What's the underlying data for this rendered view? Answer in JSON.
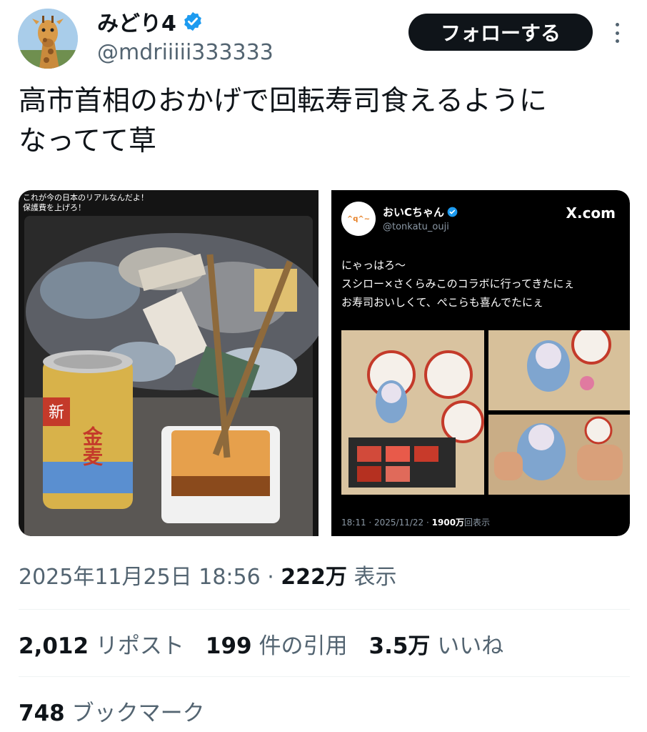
{
  "author": {
    "display_name": "みどり4",
    "handle": "@mdriiiii333333",
    "verified": true,
    "avatar_icon": "giraffe-avatar"
  },
  "actions": {
    "follow_label": "フォローする",
    "more_icon": "more-dots-icon"
  },
  "tweet": {
    "text": "高市首相のおかげで回転寿司食えるように\nなってて草"
  },
  "media": {
    "left_photo": {
      "overlay_line1": "これが今の日本のリアルなんだよ！",
      "overlay_line2": "保護費を上げろ！",
      "can_label": "金麦"
    },
    "right_embed": {
      "avatar_text": "^q^~",
      "name": "おいCちゃん",
      "handle": "@tonkatu_ouji",
      "brand": "X.com",
      "lines": [
        "にゃっはろ〜",
        "スシロー×さくらみこのコラボに行ってきたにぇ",
        "お寿司おいしくて、ぺこらも喜んでたにぇ"
      ],
      "meta_date": "18:11 · 2025/11/22 · ",
      "meta_views": "1900万",
      "meta_views_suffix": "回表示"
    }
  },
  "footer": {
    "date": "2025年11月25日 18:56 · ",
    "views": "222万",
    "views_label": " 表示",
    "reposts_count": "2,012",
    "reposts_label": " リポスト",
    "quotes_count": "199",
    "quotes_label": " 件の引用",
    "likes_count": "3.5万",
    "likes_label": " いいね",
    "bookmarks_count": "748",
    "bookmarks_label": " ブックマーク"
  },
  "colors": {
    "verified_blue": "#1d9bf0",
    "text_primary": "#0f1419",
    "text_secondary": "#536471",
    "follow_bg": "#0f1419"
  }
}
